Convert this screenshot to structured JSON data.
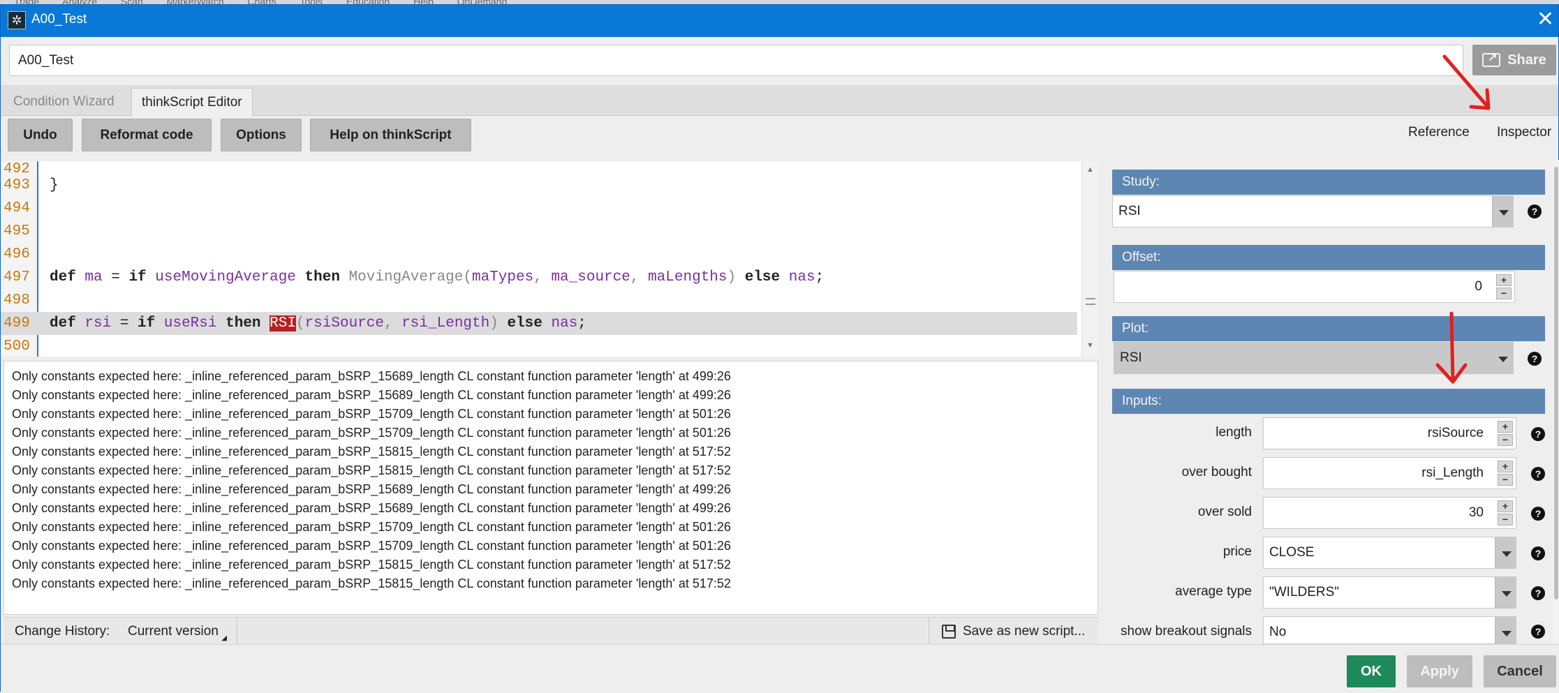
{
  "background_menu": "Trade Analyze Scan MarketWatch Charts Tools Education Help OnDemand",
  "window": {
    "title": "A00_Test",
    "close_glyph": "✕"
  },
  "name_input": {
    "value": "A00_Test"
  },
  "share_button": {
    "label": "Share"
  },
  "tabs": [
    {
      "label": "Condition Wizard",
      "active": false
    },
    {
      "label": "thinkScript Editor",
      "active": true
    }
  ],
  "toolbar": {
    "undo": "Undo",
    "reformat": "Reformat code",
    "options": "Options",
    "help": "Help on thinkScript"
  },
  "side_links": {
    "reference": "Reference",
    "inspector": "Inspector"
  },
  "code": {
    "lines": [
      {
        "num": "492",
        "text": ""
      },
      {
        "num": "493",
        "text": "}"
      },
      {
        "num": "494",
        "text": ""
      },
      {
        "num": "495",
        "text": ""
      },
      {
        "num": "496",
        "text": ""
      },
      {
        "num": "497",
        "text": "def ma = if useMovingAverage then MovingAverage(maTypes, ma_source, maLengths) else nas;"
      },
      {
        "num": "498",
        "text": ""
      },
      {
        "num": "499",
        "text": "def rsi = if useRsi then RSI(rsiSource, rsi_Length) else nas;",
        "current": true
      },
      {
        "num": "500",
        "text": ""
      }
    ],
    "highlighted_token": "RSI"
  },
  "messages": [
    "Only constants expected here: _inline_referenced_param_bSRP_15689_length CL constant function parameter 'length' at 499:26",
    "Only constants expected here: _inline_referenced_param_bSRP_15689_length CL constant function parameter 'length' at 499:26",
    "Only constants expected here: _inline_referenced_param_bSRP_15709_length CL constant function parameter 'length' at 501:26",
    "Only constants expected here: _inline_referenced_param_bSRP_15709_length CL constant function parameter 'length' at 501:26",
    "Only constants expected here: _inline_referenced_param_bSRP_15815_length CL constant function parameter 'length' at 517:52",
    "Only constants expected here: _inline_referenced_param_bSRP_15815_length CL constant function parameter 'length' at 517:52",
    "Only constants expected here: _inline_referenced_param_bSRP_15689_length CL constant function parameter 'length' at 499:26",
    "Only constants expected here: _inline_referenced_param_bSRP_15689_length CL constant function parameter 'length' at 499:26",
    "Only constants expected here: _inline_referenced_param_bSRP_15709_length CL constant function parameter 'length' at 501:26",
    "Only constants expected here: _inline_referenced_param_bSRP_15709_length CL constant function parameter 'length' at 501:26",
    "Only constants expected here: _inline_referenced_param_bSRP_15815_length CL constant function parameter 'length' at 517:52",
    "Only constants expected here: _inline_referenced_param_bSRP_15815_length CL constant function parameter 'length' at 517:52"
  ],
  "footer": {
    "history_label": "Change History:",
    "history_value": "Current version",
    "save_label": "Save as new script..."
  },
  "inspector": {
    "study_header": "Study:",
    "study_value": "RSI",
    "offset_header": "Offset:",
    "offset_value": "0",
    "plot_header": "Plot:",
    "plot_value": "RSI",
    "inputs_header": "Inputs:",
    "inputs": [
      {
        "label": "length",
        "value": "rsiSource",
        "kind": "number"
      },
      {
        "label": "over bought",
        "value": "rsi_Length",
        "kind": "number"
      },
      {
        "label": "over sold",
        "value": "30",
        "kind": "number"
      },
      {
        "label": "price",
        "value": "CLOSE",
        "kind": "select"
      },
      {
        "label": "average type",
        "value": "\"WILDERS\"",
        "kind": "select"
      },
      {
        "label": "show breakout signals",
        "value": "No",
        "kind": "select"
      }
    ]
  },
  "buttons": {
    "ok": "OK",
    "apply": "Apply",
    "cancel": "Cancel"
  },
  "colors": {
    "titlebar": "#0a78d7",
    "section_header": "#5e86b2",
    "ok_button": "#1e8a5a",
    "highlight": "#b22222",
    "annotation_arrow": "#e02020"
  }
}
